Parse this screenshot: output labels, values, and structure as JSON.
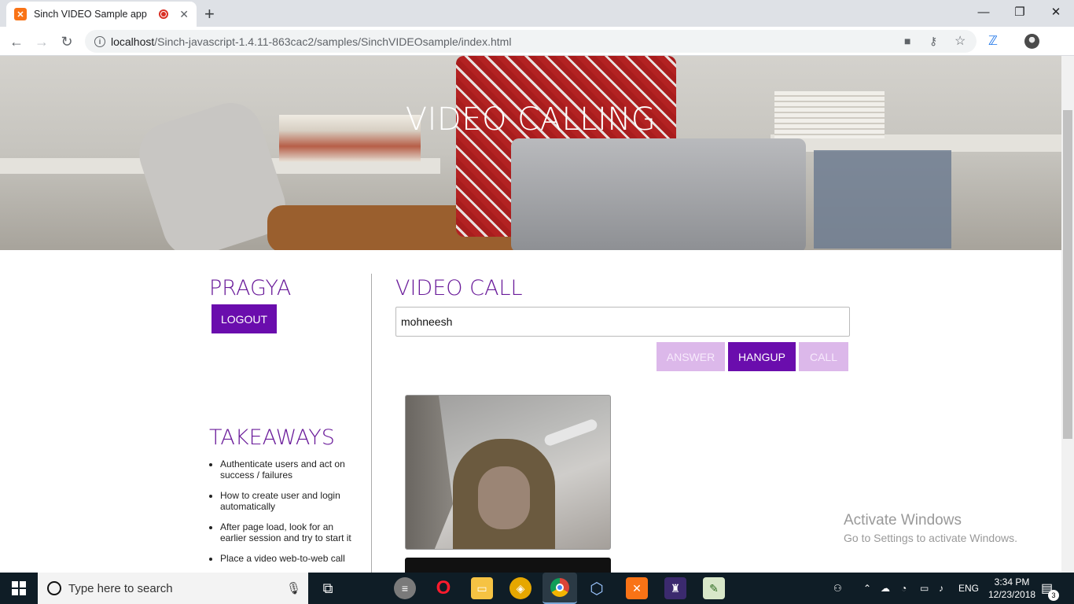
{
  "browser": {
    "tab_title": "Sinch VIDEO Sample app",
    "url_host": "localhost",
    "url_path": "/Sinch-javascript-1.4.11-863cac2/samples/SinchVIDEOsample/index.html"
  },
  "hero": {
    "title": "VIDEO CALLING"
  },
  "user_panel": {
    "username": "PRAGYA",
    "logout_label": "LOGOUT"
  },
  "takeaways": {
    "heading": "TAKEAWAYS",
    "items": [
      "Authenticate users and act on success / failures",
      "How to create user and login automatically",
      "After page load, look for an earlier session and try to start it",
      "Place a video web-to-web call"
    ]
  },
  "video_call": {
    "heading": "VIDEO CALL",
    "callee_value": "mohneesh",
    "answer_label": "ANSWER",
    "hangup_label": "HANGUP",
    "call_label": "CALL"
  },
  "watermark": {
    "line1": "Activate Windows",
    "line2": "Go to Settings to activate Windows."
  },
  "taskbar": {
    "search_placeholder": "Type here to search",
    "language": "ENG",
    "time": "3:34 PM",
    "date": "12/23/2018",
    "notification_count": "3"
  }
}
